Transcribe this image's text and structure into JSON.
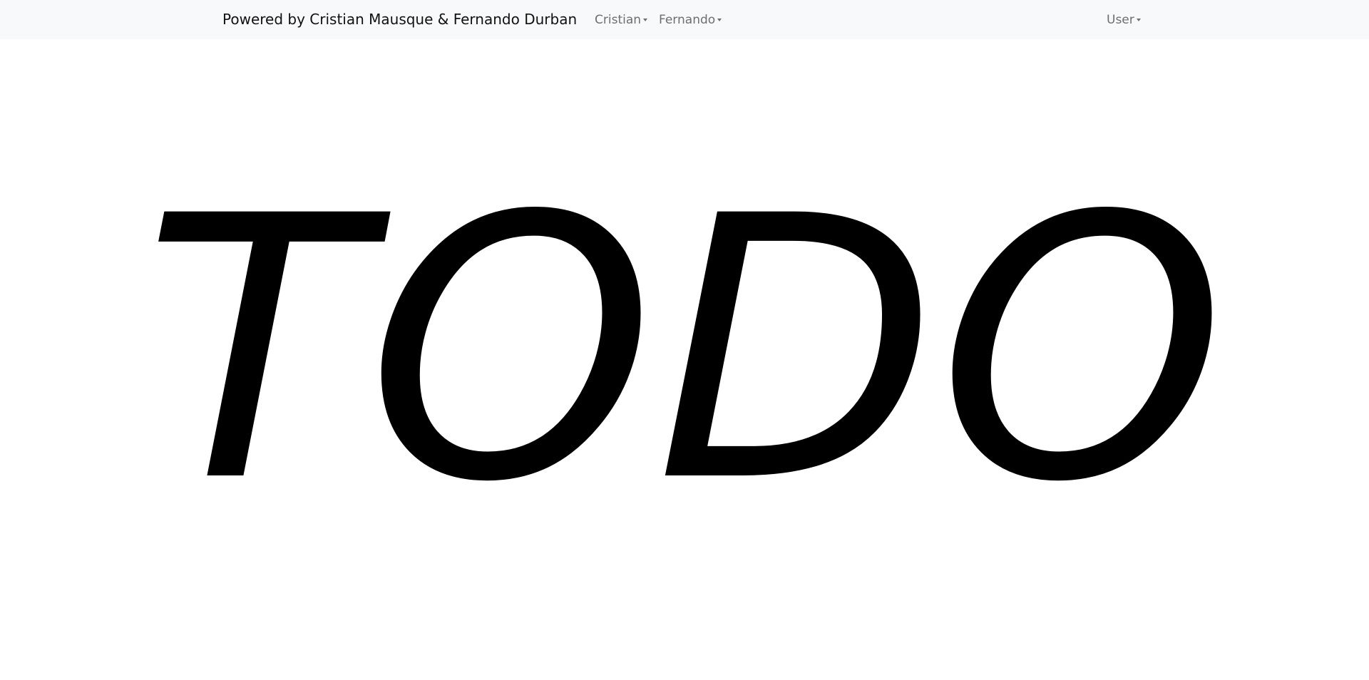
{
  "navbar": {
    "brand": "Powered by Cristian Mausque & Fernando Durban",
    "menus": [
      {
        "label": "Cristian"
      },
      {
        "label": "Fernando"
      }
    ],
    "user_menu": {
      "label": "User"
    }
  },
  "main": {
    "hero_text": "TODO"
  }
}
